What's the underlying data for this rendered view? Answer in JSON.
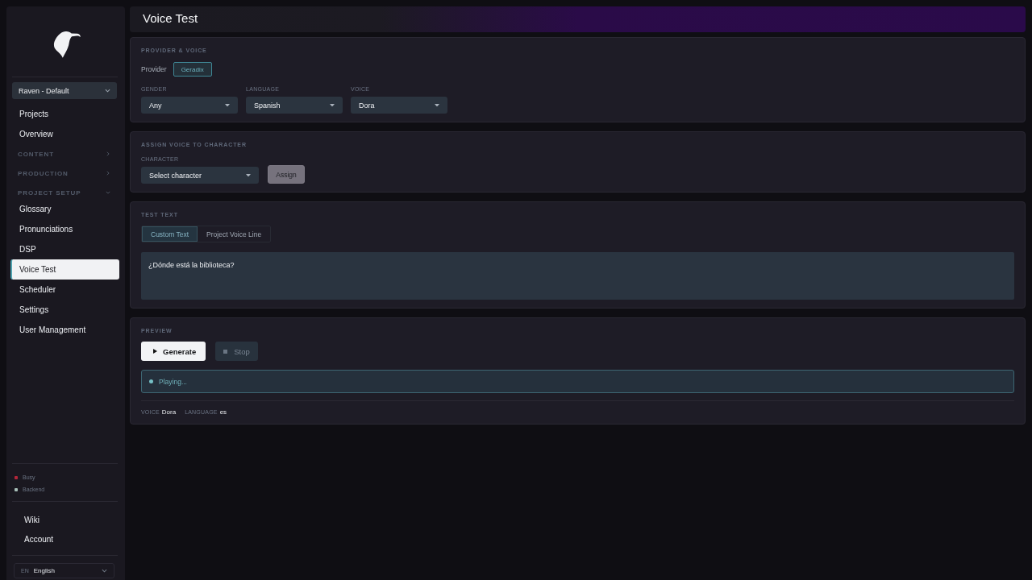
{
  "sidebar": {
    "project_select": {
      "value": "Raven - Default"
    },
    "nav": [
      {
        "label": "Projects",
        "selected": false
      },
      {
        "label": "Overview",
        "selected": false
      }
    ],
    "sections": [
      {
        "label": "CONTENT",
        "expanded": false
      },
      {
        "label": "PRODUCTION",
        "expanded": false
      },
      {
        "label": "PROJECT SETUP",
        "expanded": true,
        "children": [
          {
            "label": "Glossary",
            "selected": false
          },
          {
            "label": "Pronunciations",
            "selected": false
          },
          {
            "label": "DSP",
            "selected": false
          },
          {
            "label": "Voice Test",
            "selected": true
          },
          {
            "label": "Scheduler",
            "selected": false
          },
          {
            "label": "Settings",
            "selected": false
          },
          {
            "label": "User Management",
            "selected": false
          }
        ]
      }
    ],
    "status": [
      {
        "label": "Busy",
        "color": "#b3263a"
      },
      {
        "label": "Backend",
        "color": "#a7bfb8"
      }
    ],
    "links": [
      "Wiki",
      "Account"
    ],
    "language_select": {
      "code": "EN",
      "value": "English"
    }
  },
  "page_title": "Voice Test",
  "provider_voice": {
    "heading": "PROVIDER & VOICE",
    "provider_label": "Provider",
    "providers": [
      {
        "label": "Geradix",
        "selected": true
      }
    ],
    "selects": [
      {
        "label": "GENDER",
        "value": "Any"
      },
      {
        "label": "LANGUAGE",
        "value": "Spanish"
      },
      {
        "label": "VOICE",
        "value": "Dora"
      }
    ]
  },
  "assign": {
    "heading": "ASSIGN VOICE TO CHARACTER",
    "select": {
      "label": "CHARACTER",
      "value": "Select character"
    },
    "button": {
      "label": "Assign",
      "disabled": true
    }
  },
  "test_text": {
    "heading": "TEST TEXT",
    "tabs": [
      {
        "label": "Custom Text",
        "selected": true
      },
      {
        "label": "Project Voice Line",
        "selected": false
      }
    ],
    "text": "¿Dónde está la biblioteca?"
  },
  "preview": {
    "heading": "PREVIEW",
    "buttons": [
      {
        "kind": "play",
        "label": "Generate",
        "disabled": false
      },
      {
        "kind": "stop",
        "label": "Stop",
        "disabled": true
      }
    ],
    "status": "Playing...",
    "meta": [
      {
        "label": "VOICE",
        "value": "Dora"
      },
      {
        "label": "LANGUAGE",
        "value": "es"
      }
    ]
  }
}
